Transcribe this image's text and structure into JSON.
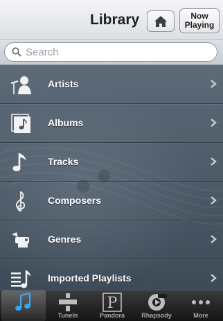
{
  "header": {
    "title": "Library",
    "now_playing": [
      "Now",
      "Playing"
    ]
  },
  "search": {
    "placeholder": "Search"
  },
  "library": {
    "items": [
      {
        "label": "Artists",
        "icon": "artists-icon"
      },
      {
        "label": "Albums",
        "icon": "albums-icon"
      },
      {
        "label": "Tracks",
        "icon": "tracks-icon"
      },
      {
        "label": "Composers",
        "icon": "composers-icon"
      },
      {
        "label": "Genres",
        "icon": "genres-icon"
      },
      {
        "label": "Imported Playlists",
        "icon": "imported-playlists-icon"
      }
    ]
  },
  "tabs": [
    {
      "label": "",
      "icon": "music-note-icon",
      "selected": true
    },
    {
      "label": "TuneIn",
      "icon": "tunein-icon"
    },
    {
      "label": "Pandora",
      "icon": "pandora-icon"
    },
    {
      "label": "Rhapsody",
      "icon": "rhapsody-icon"
    },
    {
      "label": "More",
      "icon": "more-icon"
    }
  ],
  "colors": {
    "tab_selected_accent": "#3aa4f2",
    "list_bg": "#4b5a69"
  }
}
